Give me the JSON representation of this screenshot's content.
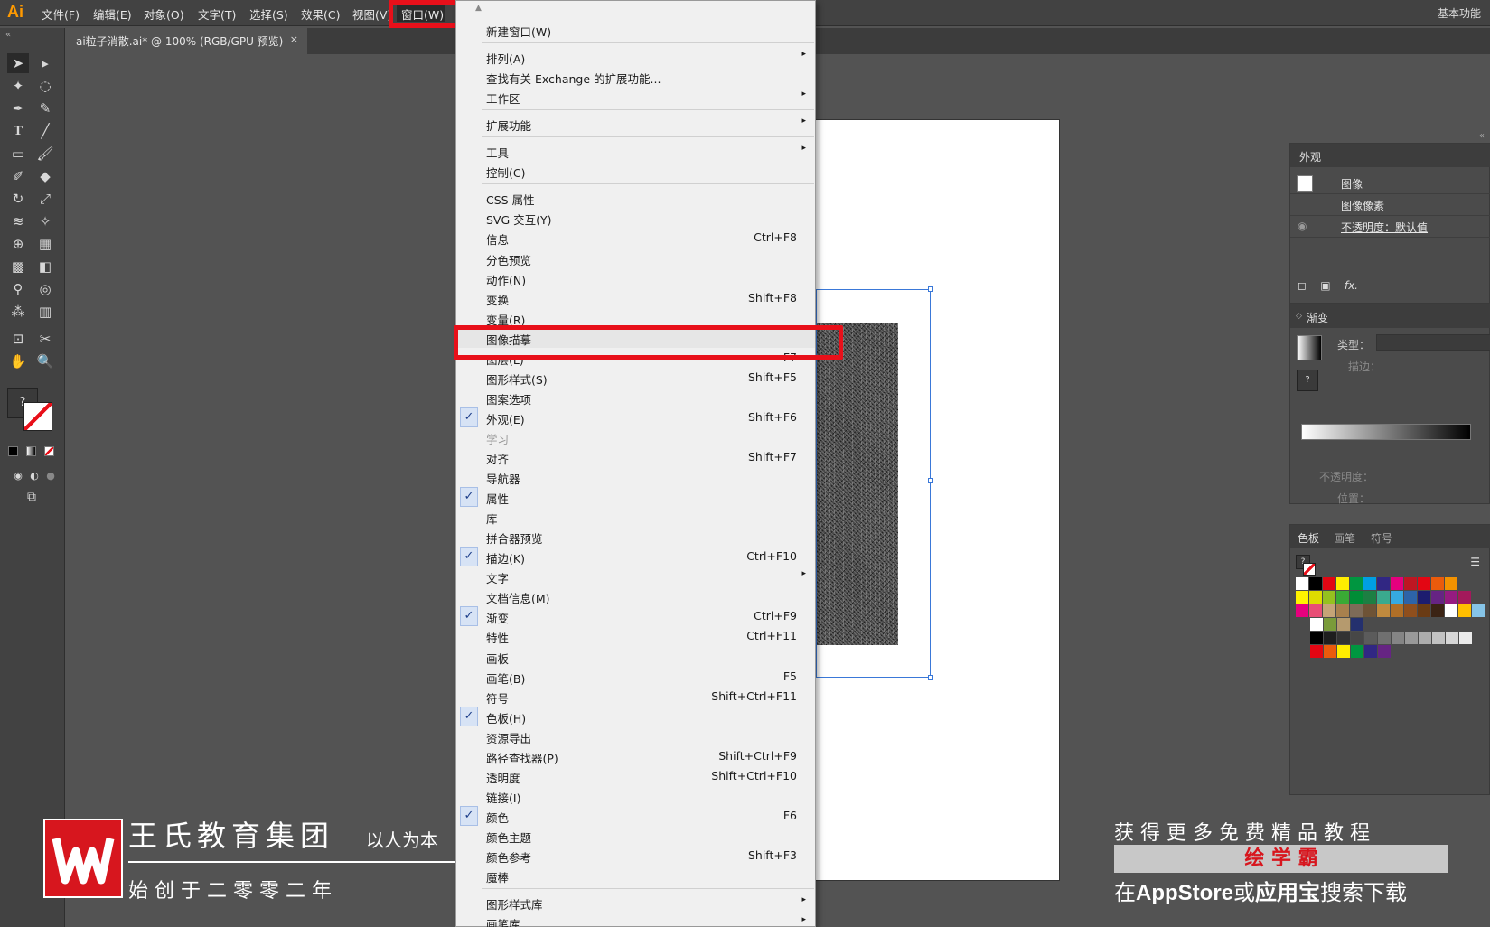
{
  "app": {
    "logo": "Ai",
    "workspace": "基本功能"
  },
  "menubar": {
    "items": [
      "文件(F)",
      "编辑(E)",
      "对象(O)",
      "文字(T)",
      "选择(S)",
      "效果(C)",
      "视图(V)"
    ],
    "active": "窗口(W)"
  },
  "document_tab": {
    "title": "ai粒子消散.ai* @ 100% (RGB/GPU 预览)",
    "close": "×"
  },
  "window_menu": {
    "scroll_up": "▲",
    "submenu_arrow": "▸",
    "check_mark": "✓",
    "items": [
      {
        "label": "新建窗口(W)"
      },
      {
        "label": "排列(A)",
        "submenu": true
      },
      {
        "label": "查找有关 Exchange 的扩展功能..."
      },
      {
        "label": "工作区",
        "submenu": true
      },
      {
        "label": "扩展功能",
        "submenu": true
      },
      {
        "label": "工具",
        "submenu": true
      },
      {
        "label": "控制(C)"
      },
      {
        "label": "CSS 属性"
      },
      {
        "label": "SVG 交互(Y)"
      },
      {
        "label": "信息",
        "shortcut": "Ctrl+F8"
      },
      {
        "label": "分色预览"
      },
      {
        "label": "动作(N)"
      },
      {
        "label": "变换",
        "shortcut": "Shift+F8"
      },
      {
        "label": "变量(R)"
      },
      {
        "label": "图像描摹",
        "highlighted": true
      },
      {
        "label": "图层(L)",
        "shortcut": "F7"
      },
      {
        "label": "图形样式(S)",
        "shortcut": "Shift+F5"
      },
      {
        "label": "图案选项"
      },
      {
        "label": "外观(E)",
        "shortcut": "Shift+F6",
        "checked": true
      },
      {
        "label": "学习",
        "disabled": true
      },
      {
        "label": "对齐",
        "shortcut": "Shift+F7"
      },
      {
        "label": "导航器"
      },
      {
        "label": "属性",
        "checked": true
      },
      {
        "label": "库"
      },
      {
        "label": "拼合器预览"
      },
      {
        "label": "描边(K)",
        "shortcut": "Ctrl+F10",
        "checked": true
      },
      {
        "label": "文字",
        "submenu": true
      },
      {
        "label": "文档信息(M)"
      },
      {
        "label": "渐变",
        "shortcut": "Ctrl+F9",
        "checked": true
      },
      {
        "label": "特性",
        "shortcut": "Ctrl+F11"
      },
      {
        "label": "画板"
      },
      {
        "label": "画笔(B)",
        "shortcut": "F5"
      },
      {
        "label": "符号",
        "shortcut": "Shift+Ctrl+F11"
      },
      {
        "label": "色板(H)",
        "checked": true
      },
      {
        "label": "资源导出"
      },
      {
        "label": "路径查找器(P)",
        "shortcut": "Shift+Ctrl+F9"
      },
      {
        "label": "透明度",
        "shortcut": "Shift+Ctrl+F10"
      },
      {
        "label": "链接(I)"
      },
      {
        "label": "颜色",
        "shortcut": "F6",
        "checked": true
      },
      {
        "label": "颜色主题"
      },
      {
        "label": "颜色参考",
        "shortcut": "Shift+F3"
      },
      {
        "label": "魔棒"
      },
      {
        "label": "图形样式库",
        "submenu": true
      },
      {
        "label": "画笔库",
        "submenu": true
      }
    ]
  },
  "appearance_panel": {
    "tab": "外观",
    "rows": [
      "图像",
      "图像像素",
      "不透明度：默认值"
    ],
    "fx_icon": "fx."
  },
  "gradient_panel": {
    "tab": "渐变",
    "type_label": "类型：",
    "stroke_label": "描边：",
    "opacity_label": "不透明度：",
    "location_label": "位置："
  },
  "swatches_panel": {
    "tabs": [
      "色板",
      "画笔",
      "符号"
    ],
    "unknown_fill": "?",
    "rows": [
      [
        "#ffffff",
        "#000000",
        "#e20613",
        "#ffed00",
        "#009640",
        "#009fe3",
        "#312783",
        "#e5007e",
        "#be1622",
        "#e30613",
        "#ea5b0c",
        "#f39200"
      ],
      [
        "#fff200",
        "#dedc00",
        "#95c11f",
        "#3aaa35",
        "#008d36",
        "#1d7f43",
        "#3aaa8e",
        "#36a9e1",
        "#2d64a8",
        "#1d1d6f",
        "#662483",
        "#951b81",
        "#a3195b"
      ],
      [
        "#e6007e",
        "#e84e76",
        "#c6a477",
        "#a8804d",
        "#7d6b58",
        "#6e5336",
        "#c08a3e",
        "#b06f27",
        "#8f4f1d",
        "#6a3b14",
        "#3b2314",
        "#ffffff",
        "#ffbe00",
        "#86c4e8"
      ],
      [
        "#ffffff",
        "#7a9b3a",
        "#b59a6e",
        "#24306e"
      ],
      [
        "#000000",
        "#1e1e1e",
        "#333333",
        "#474747",
        "#5b5b5b",
        "#707070",
        "#858585",
        "#999999",
        "#adadad",
        "#c2c2c2",
        "#d6d6d6",
        "#ebebeb"
      ],
      [
        "#e30613",
        "#ea5b0c",
        "#ffed00",
        "#009640",
        "#312783",
        "#662483"
      ]
    ]
  },
  "watermark": {
    "company": "王氏教育集团",
    "slogan": "以人为本",
    "founded": "始 创 于 二 零 零 二 年",
    "promo": "获 得 更 多 免 费 精 品 教 程",
    "brand": "绘 学 霸",
    "store_prefix": "在",
    "store_name": "AppStore",
    "store_mid": "或",
    "store_app": "应用宝",
    "store_suffix": "搜索下载"
  },
  "colors": {
    "highlight_box": "#e8101a",
    "selection": "#3a78d8",
    "menu_bg": "#f0f0f0",
    "app_bg": "#535353"
  }
}
